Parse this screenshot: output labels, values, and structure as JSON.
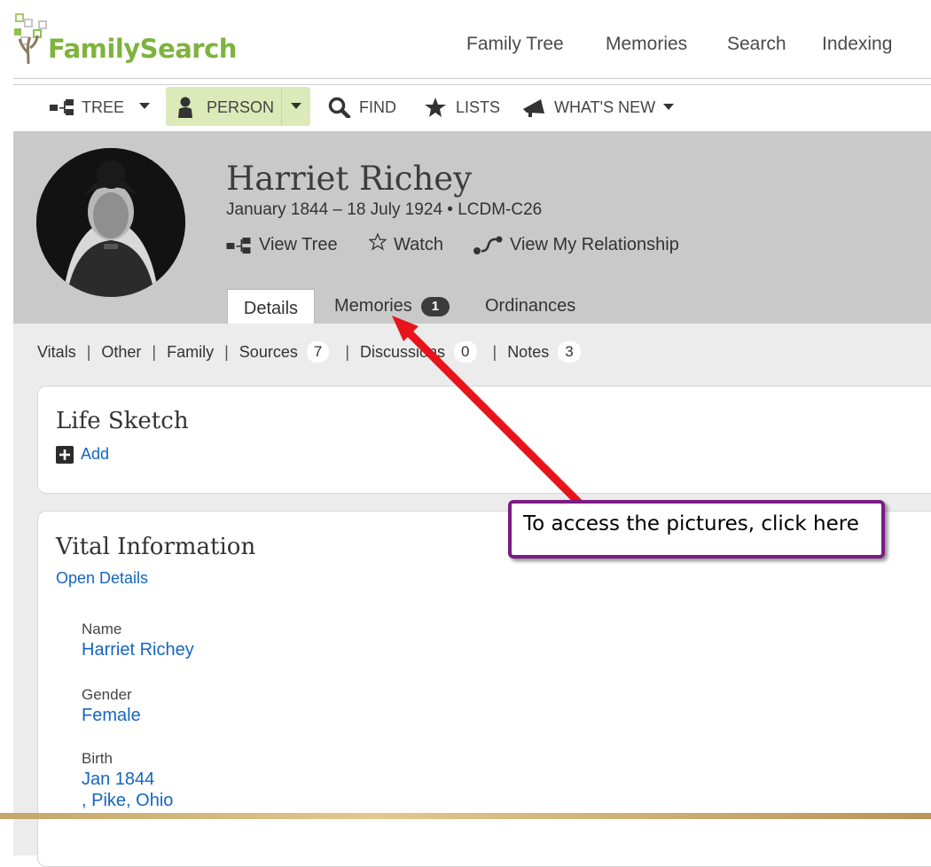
{
  "header": {
    "logo_text": "FamilySearch",
    "nav": [
      "Family Tree",
      "Memories",
      "Search",
      "Indexing"
    ]
  },
  "subnav": {
    "tree": "TREE",
    "person": "PERSON",
    "find": "FIND",
    "lists": "LISTS",
    "whats_new": "WHAT'S NEW"
  },
  "person": {
    "name": "Harriet Richey",
    "dates": "January 1844 – 18 July 1924 • LCDM-C26",
    "actions": {
      "view_tree": "View Tree",
      "watch": "Watch",
      "view_relationship": "View My Relationship"
    }
  },
  "tabs": {
    "details": "Details",
    "memories": "Memories",
    "memories_count": "1",
    "ordinances": "Ordinances"
  },
  "anchors": {
    "vitals": "Vitals",
    "other": "Other",
    "family": "Family",
    "sources": "Sources",
    "sources_count": "7",
    "discussions": "Discussions",
    "discussions_count": "0",
    "notes": "Notes",
    "notes_count": "3"
  },
  "life_sketch": {
    "title": "Life Sketch",
    "add": "Add"
  },
  "vital_info": {
    "title": "Vital Information",
    "open_details": "Open Details",
    "name_label": "Name",
    "name_value": "Harriet Richey",
    "gender_label": "Gender",
    "gender_value": "Female",
    "birth_label": "Birth",
    "birth_date": "Jan 1844",
    "birth_place": ", Pike, Ohio"
  },
  "callout": {
    "text": "To access the pictures, click here"
  },
  "colors": {
    "brand_green": "#7eb33d",
    "link_blue": "#1565c0",
    "callout_border": "#7b1b83",
    "arrow_red": "#e8141b"
  }
}
